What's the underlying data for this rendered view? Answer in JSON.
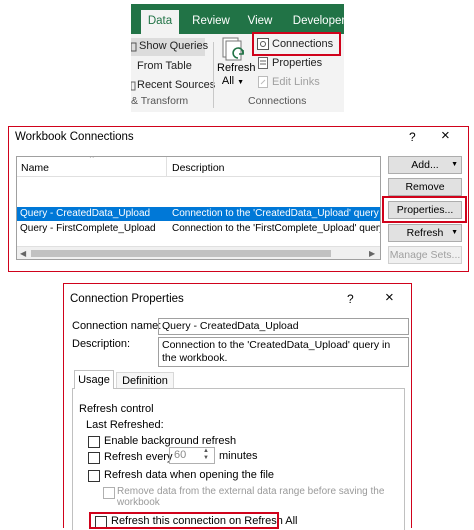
{
  "ribbon": {
    "tabs": [
      "Data",
      "Review",
      "View",
      "Developer"
    ],
    "show_queries": "Show Queries",
    "from_table": "From Table",
    "recent_sources": "Recent Sources",
    "transform_group": "& Transform",
    "refresh_all_line1": "Refresh",
    "refresh_all_line2": "All",
    "connections": "Connections",
    "properties": "Properties",
    "edit_links": "Edit Links",
    "connections_group": "Connections"
  },
  "workbook_connections": {
    "title": "Workbook Connections",
    "help": "?",
    "close": "×",
    "columns": [
      "Name",
      "Description"
    ],
    "rows": [
      {
        "name": "Query - CreatedData_Upload",
        "description": "Connection to the 'CreatedData_Upload' query i"
      },
      {
        "name": "Query - FirstComplete_Upload",
        "description": "Connection to the 'FirstComplete_Upload' query in th"
      }
    ],
    "buttons": {
      "add": "Add...",
      "remove": "Remove",
      "properties": "Properties...",
      "refresh": "Refresh",
      "manage_sets": "Manage Sets..."
    }
  },
  "connection_properties": {
    "title": "Connection Properties",
    "help": "?",
    "close": "×",
    "connection_name_label": "Connection name:",
    "connection_name_value": "Query - CreatedData_Upload",
    "description_label": "Description:",
    "description_value": "Connection to the 'CreatedData_Upload' query in the workbook.",
    "tabs": [
      "Usage",
      "Definition"
    ],
    "refresh_control_label": "Refresh control",
    "last_refreshed_label": "Last Refreshed:",
    "enable_background_refresh": "Enable background refresh",
    "refresh_every": "Refresh every",
    "refresh_minutes_value": "60",
    "minutes": "minutes",
    "refresh_on_open": "Refresh data when opening the file",
    "remove_data_line1": "Remove data from the external data range before saving the",
    "remove_data_line2": "workbook",
    "refresh_on_refresh_all": "Refresh this connection on Refresh All"
  },
  "colors": {
    "ribbon_green": "#217346",
    "selection_blue": "#0078d7",
    "highlight_red": "#d0021b"
  }
}
